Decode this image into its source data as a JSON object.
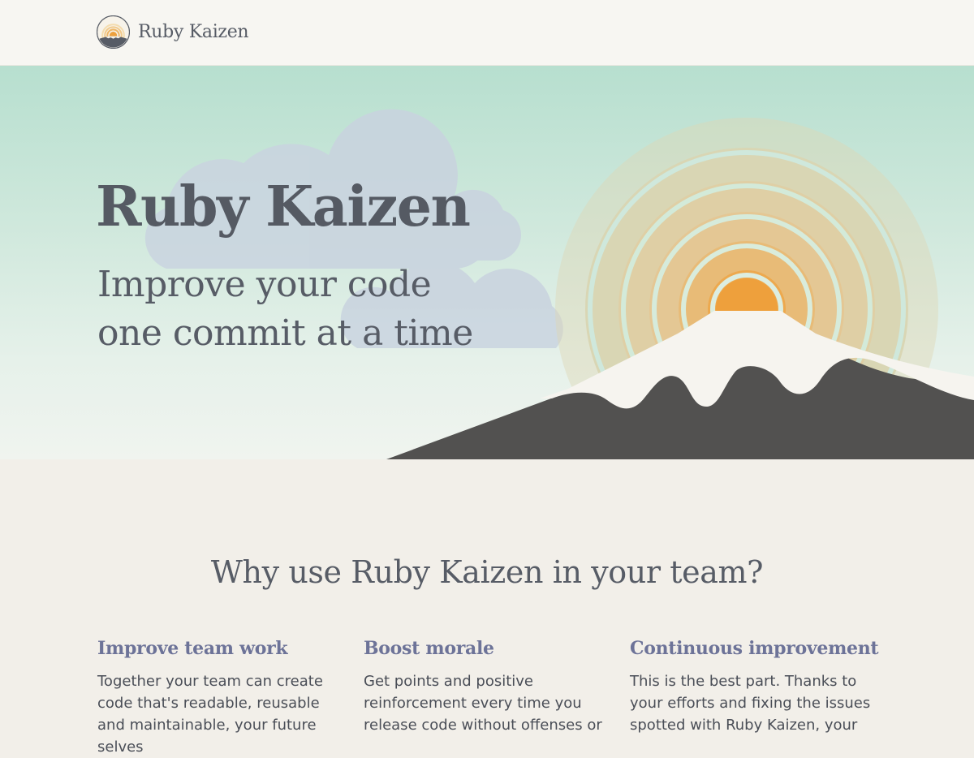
{
  "nav": {
    "brand_name": "Ruby Kaizen",
    "logo_icon": "sunrise-mountain-icon"
  },
  "hero": {
    "title": "Ruby Kaizen",
    "tagline_line1": "Improve your code",
    "tagline_line2": "one commit at a time",
    "illustration": "sunrise-over-mountain-with-clouds",
    "colors": {
      "sky_top": "#b7dfcf",
      "sun": "#eea03c",
      "mountain": "#525150",
      "snow": "#f6f4ef",
      "cloud": "#c9d3df"
    }
  },
  "features": {
    "heading": "Why use Ruby Kaizen in your team?",
    "items": [
      {
        "title": "Improve team work",
        "text": "Together your team can create code that's readable, reusable and maintainable, your future selves"
      },
      {
        "title": "Boost morale",
        "text": "Get points and positive reinforcement every time you release code without offenses or"
      },
      {
        "title": "Continuous improvement",
        "text": "This is the best part. Thanks to your efforts and fixing the issues spotted with Ruby Kaizen, your"
      }
    ]
  }
}
